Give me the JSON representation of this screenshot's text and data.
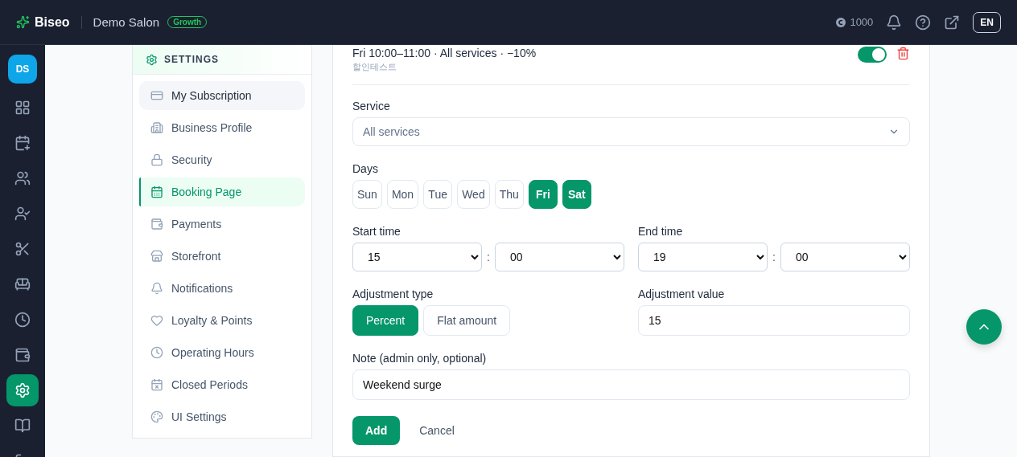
{
  "header": {
    "brand": "Biseo",
    "salon": "Demo Salon",
    "plan": "Growth",
    "credits": "1000",
    "language": "EN"
  },
  "rail": {
    "avatar": "DS",
    "items": [
      {
        "kind": "dashboard",
        "selected": false
      },
      {
        "kind": "calendar-plus",
        "selected": false
      },
      {
        "kind": "users",
        "selected": false
      },
      {
        "kind": "user-check",
        "selected": false
      },
      {
        "kind": "scissors",
        "selected": false
      },
      {
        "kind": "sofa",
        "selected": false
      },
      {
        "kind": "clock",
        "selected": false
      },
      {
        "kind": "wallet",
        "selected": false
      },
      {
        "kind": "settings",
        "selected": true
      },
      {
        "kind": "book",
        "selected": false
      },
      {
        "kind": "logout",
        "selected": false
      }
    ]
  },
  "settings": {
    "title": "SETTINGS",
    "items": [
      {
        "label": "My Subscription",
        "kind": "card",
        "selected": false,
        "hovered": true
      },
      {
        "label": "Business Profile",
        "kind": "building",
        "selected": false,
        "hovered": false
      },
      {
        "label": "Security",
        "kind": "lock",
        "selected": false,
        "hovered": false
      },
      {
        "label": "Booking Page",
        "kind": "calendar",
        "selected": true,
        "hovered": false
      },
      {
        "label": "Payments",
        "kind": "wallet",
        "selected": false,
        "hovered": false
      },
      {
        "label": "Storefront",
        "kind": "store",
        "selected": false,
        "hovered": false
      },
      {
        "label": "Notifications",
        "kind": "bell",
        "selected": false,
        "hovered": false
      },
      {
        "label": "Loyalty & Points",
        "kind": "heart",
        "selected": false,
        "hovered": false
      },
      {
        "label": "Operating Hours",
        "kind": "clock",
        "selected": false,
        "hovered": false
      },
      {
        "label": "Closed Periods",
        "kind": "calendar-x",
        "selected": false,
        "hovered": false
      },
      {
        "label": "UI Settings",
        "kind": "palette",
        "selected": false,
        "hovered": false
      }
    ]
  },
  "rule": {
    "summary": "Fri 10:00–11:00 · All services · −10%",
    "note": "할인테스트",
    "enabled": true
  },
  "form": {
    "service": {
      "label": "Service",
      "value": "All services"
    },
    "days": {
      "label": "Days",
      "items": [
        {
          "label": "Sun",
          "selected": false
        },
        {
          "label": "Mon",
          "selected": false
        },
        {
          "label": "Tue",
          "selected": false
        },
        {
          "label": "Wed",
          "selected": false
        },
        {
          "label": "Thu",
          "selected": false
        },
        {
          "label": "Fri",
          "selected": true
        },
        {
          "label": "Sat",
          "selected": true
        }
      ]
    },
    "start_time": {
      "label": "Start time",
      "hour": "15",
      "separator": ":",
      "minute": "00"
    },
    "end_time": {
      "label": "End time",
      "hour": "19",
      "separator": ":",
      "minute": "00"
    },
    "adjustment_type": {
      "label": "Adjustment type",
      "options": [
        {
          "label": "Percent",
          "selected": true
        },
        {
          "label": "Flat amount",
          "selected": false
        }
      ]
    },
    "adjustment_value": {
      "label": "Adjustment value",
      "value": "15"
    },
    "note": {
      "label": "Note (admin only, optional)",
      "value": "Weekend surge"
    },
    "buttons": {
      "add": "Add",
      "cancel": "Cancel"
    }
  }
}
